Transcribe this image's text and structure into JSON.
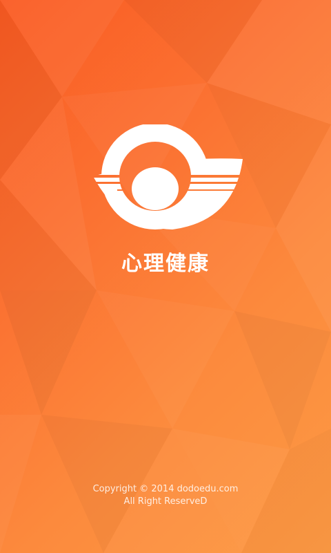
{
  "splash": {
    "app_name": "心理健康",
    "copyright": "Copyright © 2014 dodoedu.com",
    "rights": "All Right ReserveD"
  },
  "colors": {
    "background_start": "#fa5a22",
    "background_end": "#fd9a44",
    "foreground": "#ffffff"
  },
  "icons": {
    "logo": "app-logo"
  }
}
